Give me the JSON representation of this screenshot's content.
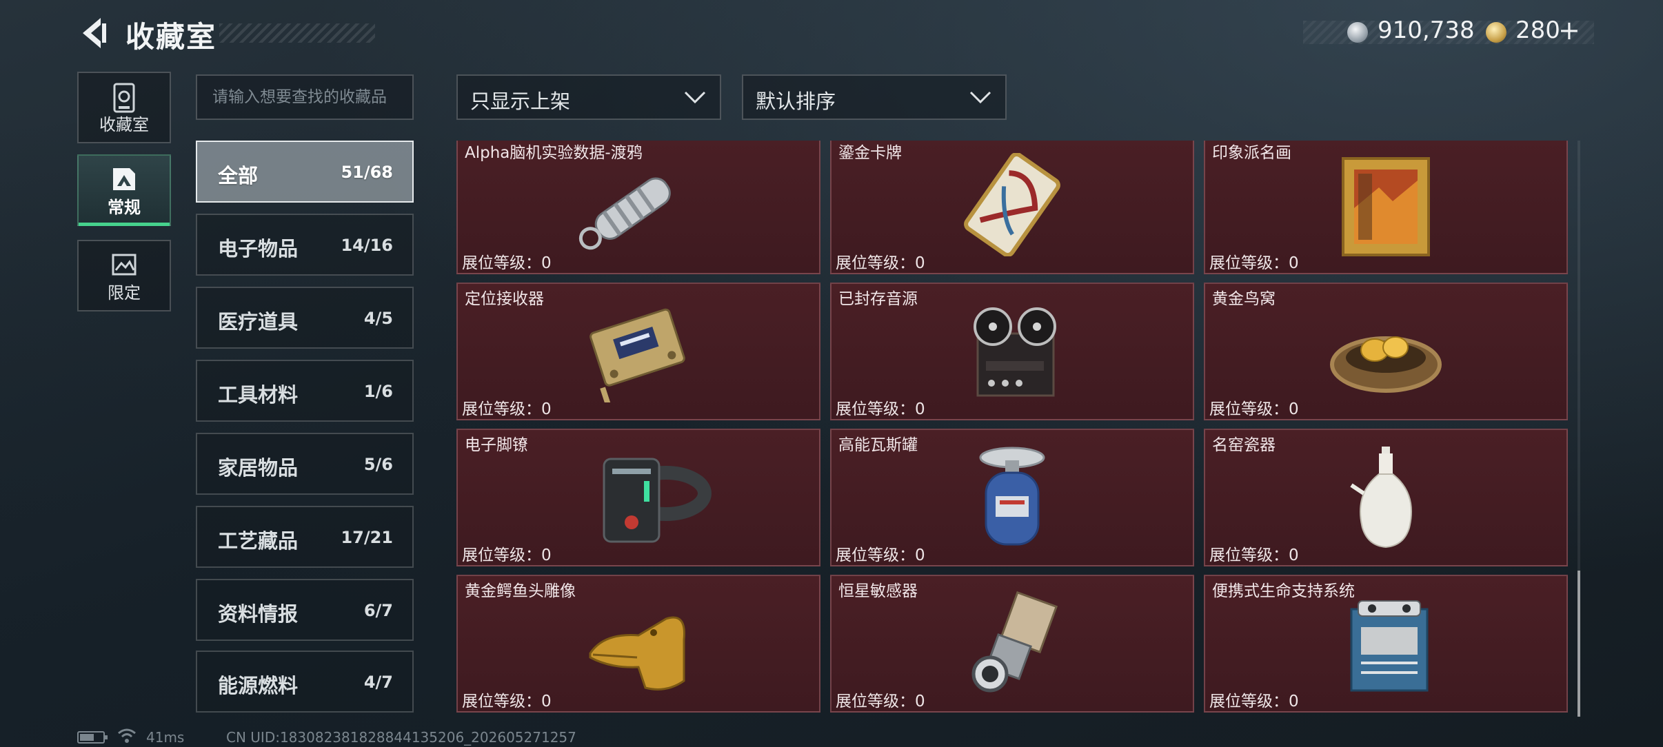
{
  "header": {
    "title": "收藏室",
    "back_icon": "chevron-left-icon",
    "currency": [
      {
        "icon": "silver-coin-icon",
        "value": "910,738"
      },
      {
        "icon": "gold-coin-icon",
        "value": "280",
        "plus": "+"
      }
    ]
  },
  "side_nav": [
    {
      "label": "收藏室",
      "icon": "cabinet-icon",
      "active": false
    },
    {
      "label": "常规",
      "icon": "picture-icon",
      "active": true
    },
    {
      "label": "限定",
      "icon": "frame-icon",
      "active": false
    }
  ],
  "search": {
    "placeholder": "请输入想要查找的收藏品",
    "value": ""
  },
  "filters": {
    "display": {
      "label": "只显示上架"
    },
    "sort": {
      "label": "默认排序"
    }
  },
  "categories": [
    {
      "name": "全部",
      "count": "51/68",
      "active": true
    },
    {
      "name": "电子物品",
      "count": "14/16",
      "active": false
    },
    {
      "name": "医疗道具",
      "count": "4/5",
      "active": false
    },
    {
      "name": "工具材料",
      "count": "1/6",
      "active": false
    },
    {
      "name": "家居物品",
      "count": "5/6",
      "active": false
    },
    {
      "name": "工艺藏品",
      "count": "17/21",
      "active": false
    },
    {
      "name": "资料情报",
      "count": "6/7",
      "active": false
    },
    {
      "name": "能源燃料",
      "count": "4/7",
      "active": false
    }
  ],
  "items": [
    {
      "name": "Alpha脑机实验数据-渡鸦",
      "level": "展位等级：0",
      "icon": "data-canister-icon"
    },
    {
      "name": "鎏金卡牌",
      "level": "展位等级：0",
      "icon": "gilded-card-icon"
    },
    {
      "name": "印象派名画",
      "level": "展位等级：0",
      "icon": "framed-painting-icon"
    },
    {
      "name": "定位接收器",
      "level": "展位等级：0",
      "icon": "locator-receiver-icon"
    },
    {
      "name": "已封存音源",
      "level": "展位等级：0",
      "icon": "tape-recorder-icon"
    },
    {
      "name": "黄金鸟窝",
      "level": "展位等级：0",
      "icon": "golden-nest-icon"
    },
    {
      "name": "电子脚镣",
      "level": "展位等级：0",
      "icon": "ankle-monitor-icon"
    },
    {
      "name": "高能瓦斯罐",
      "level": "展位等级：0",
      "icon": "gas-canister-icon"
    },
    {
      "name": "名窑瓷器",
      "level": "展位等级：0",
      "icon": "porcelain-vase-icon"
    },
    {
      "name": "黄金鳄鱼头雕像",
      "level": "展位等级：0",
      "icon": "golden-crocodile-icon"
    },
    {
      "name": "恒星敏感器",
      "level": "展位等级：0",
      "icon": "star-sensor-icon"
    },
    {
      "name": "便携式生命支持系统",
      "level": "展位等级：0",
      "icon": "life-support-icon"
    }
  ],
  "status_bar": {
    "ping": "41ms",
    "uid": "CN UID:18308238182884413520​6_202605271257"
  }
}
